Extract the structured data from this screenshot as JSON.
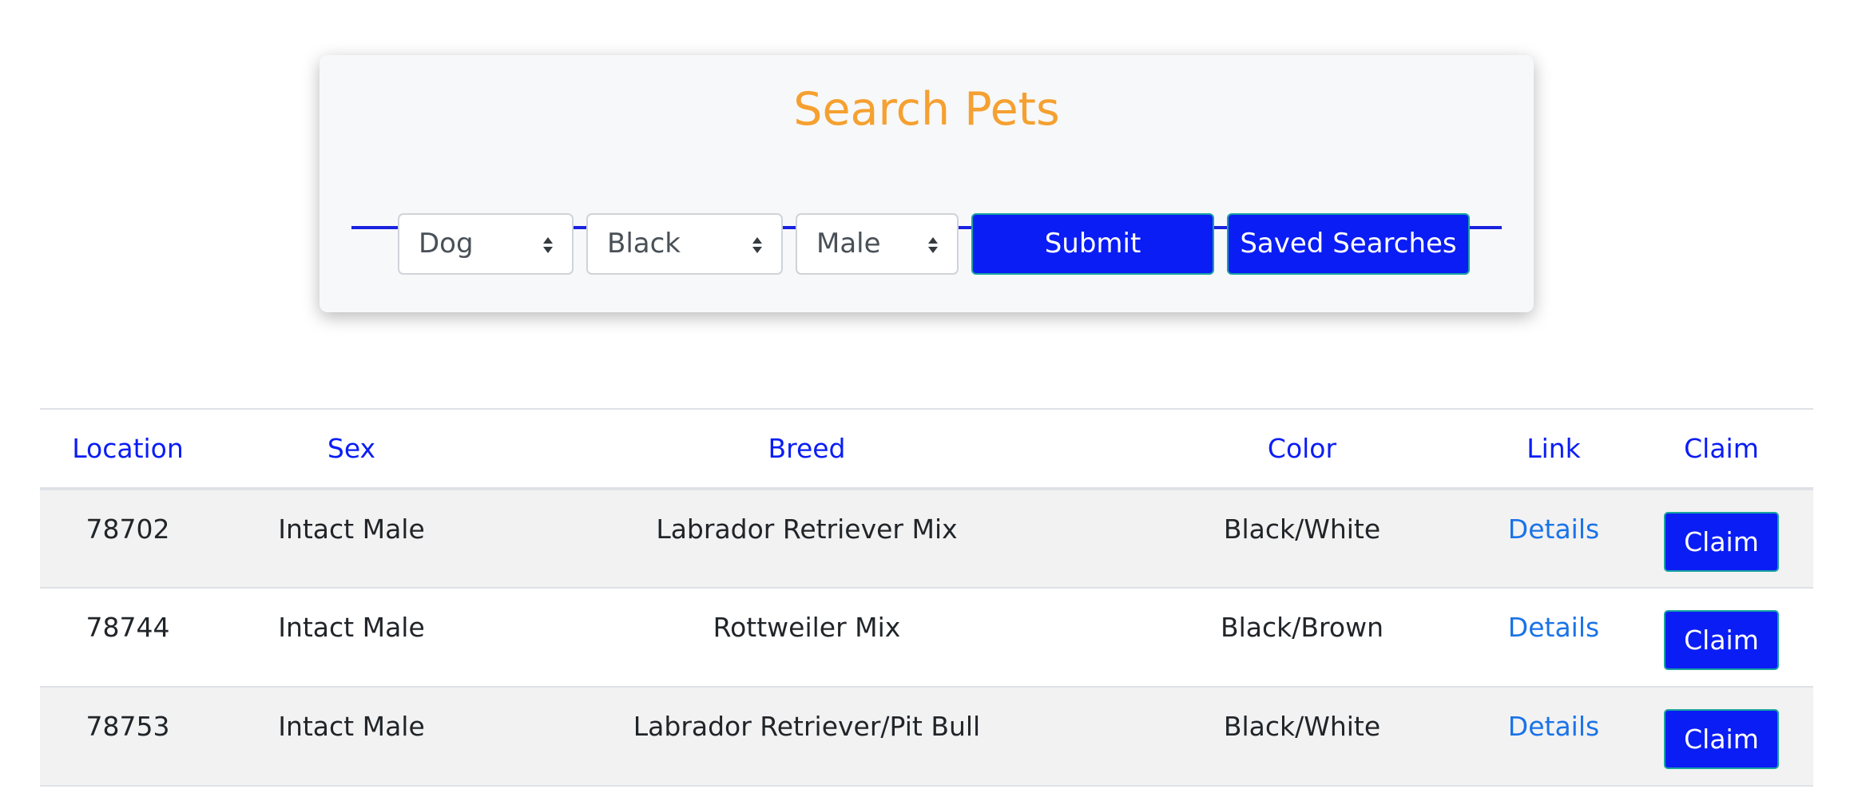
{
  "search": {
    "title": "Search Pets",
    "animal_selected": "Dog",
    "color_selected": "Black",
    "sex_selected": "Male",
    "submit_label": "Submit",
    "saved_label": "Saved Searches"
  },
  "table": {
    "headers": {
      "location": "Location",
      "sex": "Sex",
      "breed": "Breed",
      "color": "Color",
      "link": "Link",
      "claim": "Claim"
    },
    "rows": [
      {
        "location": "78702",
        "sex": "Intact Male",
        "breed": "Labrador Retriever Mix",
        "color": "Black/White",
        "link": "Details",
        "claim": "Claim"
      },
      {
        "location": "78744",
        "sex": "Intact Male",
        "breed": "Rottweiler Mix",
        "color": "Black/Brown",
        "link": "Details",
        "claim": "Claim"
      },
      {
        "location": "78753",
        "sex": "Intact Male",
        "breed": "Labrador Retriever/Pit Bull",
        "color": "Black/White",
        "link": "Details",
        "claim": "Claim"
      }
    ]
  },
  "colors": {
    "title": "#f5a030",
    "primary": "#0a1df5",
    "link": "#1a73e8",
    "rule": "#1a22e0"
  },
  "icons": {
    "select_arrow": "sort-arrows-icon"
  }
}
